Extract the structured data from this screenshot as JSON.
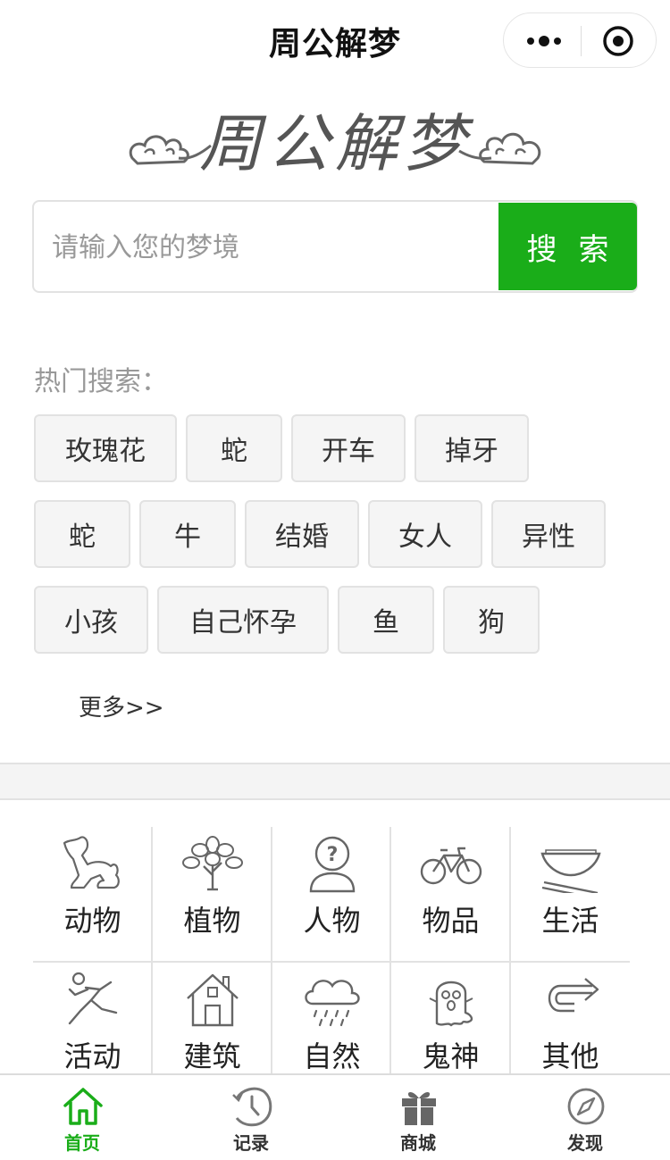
{
  "nav": {
    "title": "周公解梦"
  },
  "logo": {
    "text": "周公解梦"
  },
  "search": {
    "placeholder": "请输入您的梦境",
    "button_label": "搜索"
  },
  "hot": {
    "title": "热门搜索：",
    "tags": [
      "玫瑰花",
      "蛇",
      "开车",
      "掉牙",
      "蛇",
      "牛",
      "结婚",
      "女人",
      "异性",
      "小孩",
      "自己怀孕",
      "鱼",
      "狗"
    ],
    "more": "更多>>"
  },
  "categories": [
    {
      "label": "动物",
      "icon": "dog-icon"
    },
    {
      "label": "植物",
      "icon": "tree-icon"
    },
    {
      "label": "人物",
      "icon": "person-icon"
    },
    {
      "label": "物品",
      "icon": "bicycle-icon"
    },
    {
      "label": "生活",
      "icon": "bowl-chopsticks-icon"
    },
    {
      "label": "活动",
      "icon": "running-icon"
    },
    {
      "label": "建筑",
      "icon": "house-icon"
    },
    {
      "label": "自然",
      "icon": "rain-cloud-icon"
    },
    {
      "label": "鬼神",
      "icon": "ghost-icon"
    },
    {
      "label": "其他",
      "icon": "turn-arrow-icon"
    }
  ],
  "tabbar": [
    {
      "label": "首页",
      "icon": "home-icon",
      "active": true
    },
    {
      "label": "记录",
      "icon": "clock-icon",
      "active": false
    },
    {
      "label": "商城",
      "icon": "gift-icon",
      "active": false
    },
    {
      "label": "发现",
      "icon": "compass-icon",
      "active": false
    }
  ],
  "colors": {
    "accent": "#1aad19",
    "border": "#e2e2e2",
    "tag_bg": "#f5f5f5",
    "muted_text": "#999999"
  }
}
